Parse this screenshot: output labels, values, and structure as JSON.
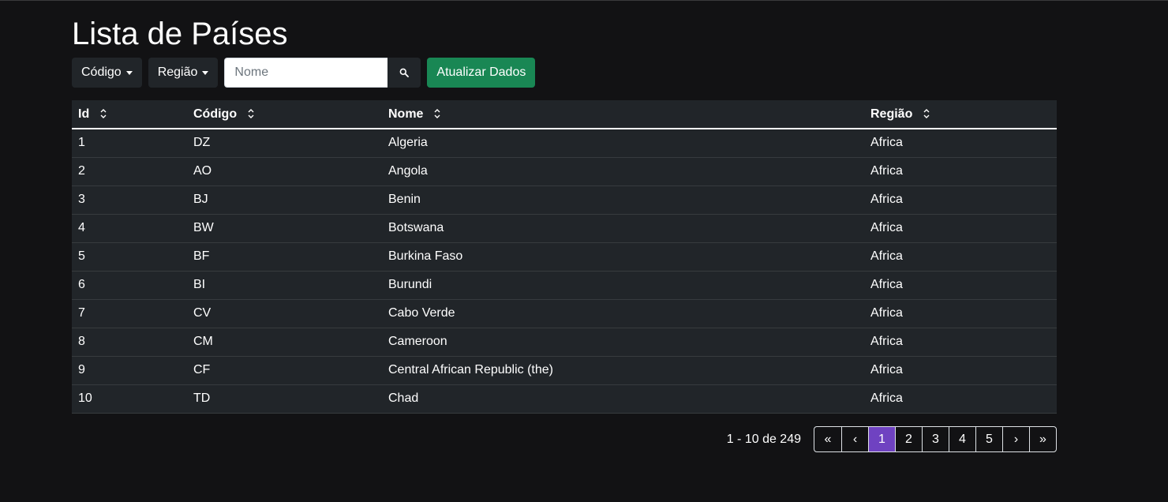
{
  "header": {
    "title": "Lista de Países"
  },
  "toolbar": {
    "code_dropdown": "Código",
    "region_dropdown": "Região",
    "search_placeholder": "Nome",
    "search_value": "",
    "update_button": "Atualizar Dados"
  },
  "table": {
    "columns": [
      "Id",
      "Código",
      "Nome",
      "Região"
    ],
    "rows": [
      [
        "1",
        "DZ",
        "Algeria",
        "Africa"
      ],
      [
        "2",
        "AO",
        "Angola",
        "Africa"
      ],
      [
        "3",
        "BJ",
        "Benin",
        "Africa"
      ],
      [
        "4",
        "BW",
        "Botswana",
        "Africa"
      ],
      [
        "5",
        "BF",
        "Burkina Faso",
        "Africa"
      ],
      [
        "6",
        "BI",
        "Burundi",
        "Africa"
      ],
      [
        "7",
        "CV",
        "Cabo Verde",
        "Africa"
      ],
      [
        "8",
        "CM",
        "Cameroon",
        "Africa"
      ],
      [
        "9",
        "CF",
        "Central African Republic (the)",
        "Africa"
      ],
      [
        "10",
        "TD",
        "Chad",
        "Africa"
      ]
    ]
  },
  "pagination": {
    "summary": "1 - 10 de 249",
    "first": "«",
    "prev": "‹",
    "pages": [
      "1",
      "2",
      "3",
      "4",
      "5"
    ],
    "active_page": "1",
    "next": "›",
    "last": "»"
  },
  "icons": {
    "search": "search-icon",
    "sort": "sort-icon"
  },
  "colors": {
    "accent_active_page": "#6f42c1",
    "update_button": "#198754",
    "background": "#121214",
    "table_bg": "#212529"
  }
}
